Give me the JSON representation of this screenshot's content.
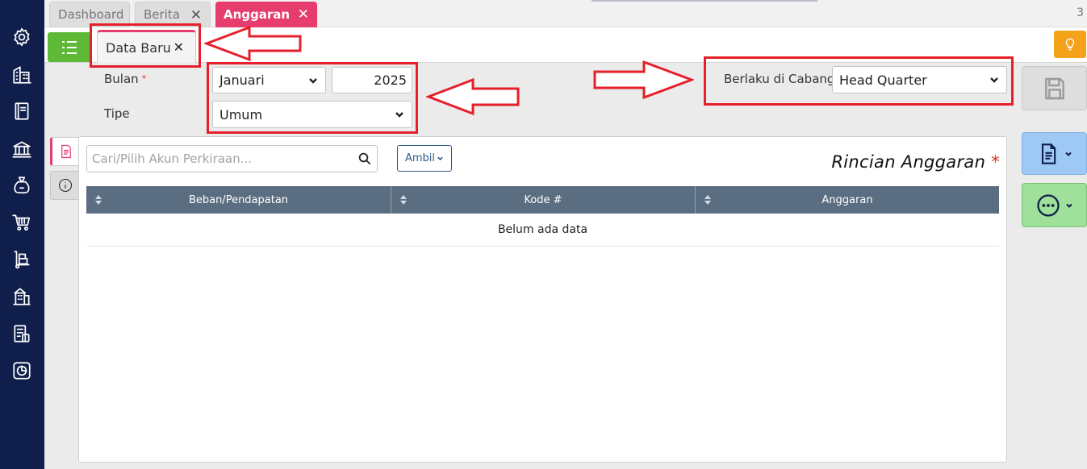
{
  "top_tabs": [
    {
      "label": "Dashboard"
    },
    {
      "label": "Berita"
    },
    {
      "label": "Anggaran"
    }
  ],
  "top_tab_count": "3",
  "sub_tab": {
    "label": "Data Baru"
  },
  "form": {
    "bulan_label": "Bulan",
    "bulan_required": "*",
    "bulan_value": "Januari",
    "tahun_value": "2025",
    "tipe_label": "Tipe",
    "tipe_value": "Umum",
    "cabang_label": "Berlaku di Cabang",
    "cabang_value": "Head Quarter"
  },
  "detail": {
    "search_placeholder": "Cari/Pilih Akun Perkiraan...",
    "ambil_label": "Ambil",
    "title": "Rincian Anggaran",
    "title_required": "*",
    "columns": [
      "Beban/Pendapatan",
      "Kode #",
      "Anggaran"
    ],
    "empty_text": "Belum ada data"
  },
  "sidebar_icons": [
    "settings-icon",
    "building-icon",
    "book-icon",
    "bank-icon",
    "money-bag-icon",
    "cart-icon",
    "hand-truck-icon",
    "store-icon",
    "tax-icon",
    "report-icon"
  ],
  "colors": {
    "sidebar": "#0f1e4a",
    "accent": "#e73c6e",
    "list_button": "#5eb936",
    "bulb_button": "#f5a21b",
    "annotation": "#e6202a",
    "table_header": "#5b6e81"
  }
}
